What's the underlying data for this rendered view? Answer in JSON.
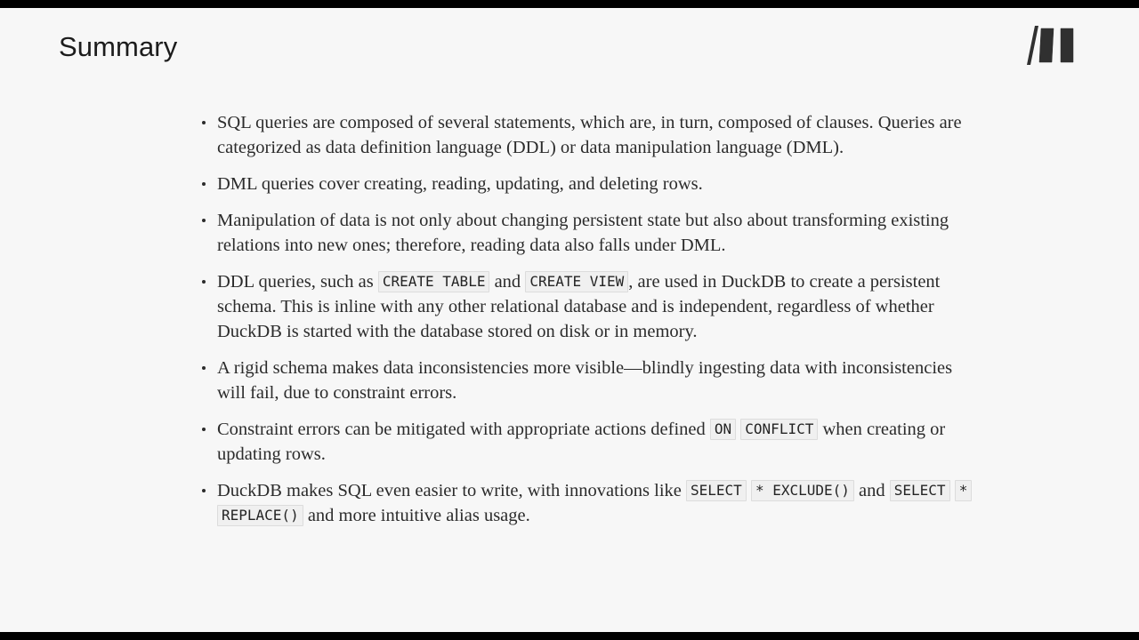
{
  "slide": {
    "title": "Summary",
    "logo_name": "manning-publications-logo",
    "background_color": "#f7f7f7",
    "letterbox_color": "#000000",
    "text_color": "#2b2b2b"
  },
  "bullets": [
    {
      "id": "bullet-sql-queries-composition",
      "parts": [
        {
          "type": "text",
          "value": "SQL queries are composed of several statements, which are, in turn, composed of clauses. Queries are categorized as data definition language (DDL) or data manipulation language (DML)."
        }
      ]
    },
    {
      "id": "bullet-dml-queries-crud",
      "parts": [
        {
          "type": "text",
          "value": "DML queries cover creating, reading, updating, and deleting rows."
        }
      ]
    },
    {
      "id": "bullet-manipulation-of-data",
      "parts": [
        {
          "type": "text",
          "value": "Manipulation of data is not only about changing persistent state but also about transforming existing relations into new ones; therefore, reading data also falls under DML."
        }
      ]
    },
    {
      "id": "bullet-ddl-queries-create",
      "parts": [
        {
          "type": "text",
          "value": "DDL queries, such as "
        },
        {
          "type": "code",
          "value": "CREATE TABLE"
        },
        {
          "type": "text",
          "value": " and "
        },
        {
          "type": "code",
          "value": "CREATE VIEW"
        },
        {
          "type": "text",
          "value": ", are used in DuckDB to create a persistent schema. This is inline with any other relational database and is independent, regardless of whether DuckDB is started with the database stored on disk or in memory."
        }
      ]
    },
    {
      "id": "bullet-rigid-schema",
      "parts": [
        {
          "type": "text",
          "value": "A rigid schema makes data inconsistencies more visible—blindly ingesting data with inconsistencies will fail, due to constraint errors."
        }
      ]
    },
    {
      "id": "bullet-constraint-errors",
      "parts": [
        {
          "type": "text",
          "value": "Constraint errors can be mitigated with appropriate actions defined "
        },
        {
          "type": "code",
          "value": "ON"
        },
        {
          "type": "text",
          "value": " "
        },
        {
          "type": "code",
          "value": "CONFLICT"
        },
        {
          "type": "text",
          "value": " when creating or updating rows."
        }
      ]
    },
    {
      "id": "bullet-duckdb-sql-innovations",
      "parts": [
        {
          "type": "text",
          "value": "DuckDB makes SQL even easier to write, with innovations like "
        },
        {
          "type": "code",
          "value": "SELECT"
        },
        {
          "type": "text",
          "value": " "
        },
        {
          "type": "code",
          "value": "* EXCLUDE()"
        },
        {
          "type": "text",
          "value": " and "
        },
        {
          "type": "code",
          "value": "SELECT"
        },
        {
          "type": "text",
          "value": " "
        },
        {
          "type": "code",
          "value": "*"
        },
        {
          "type": "text",
          "value": " "
        },
        {
          "type": "code",
          "value": "REPLACE()"
        },
        {
          "type": "text",
          "value": " and more intuitive alias usage."
        }
      ]
    }
  ]
}
